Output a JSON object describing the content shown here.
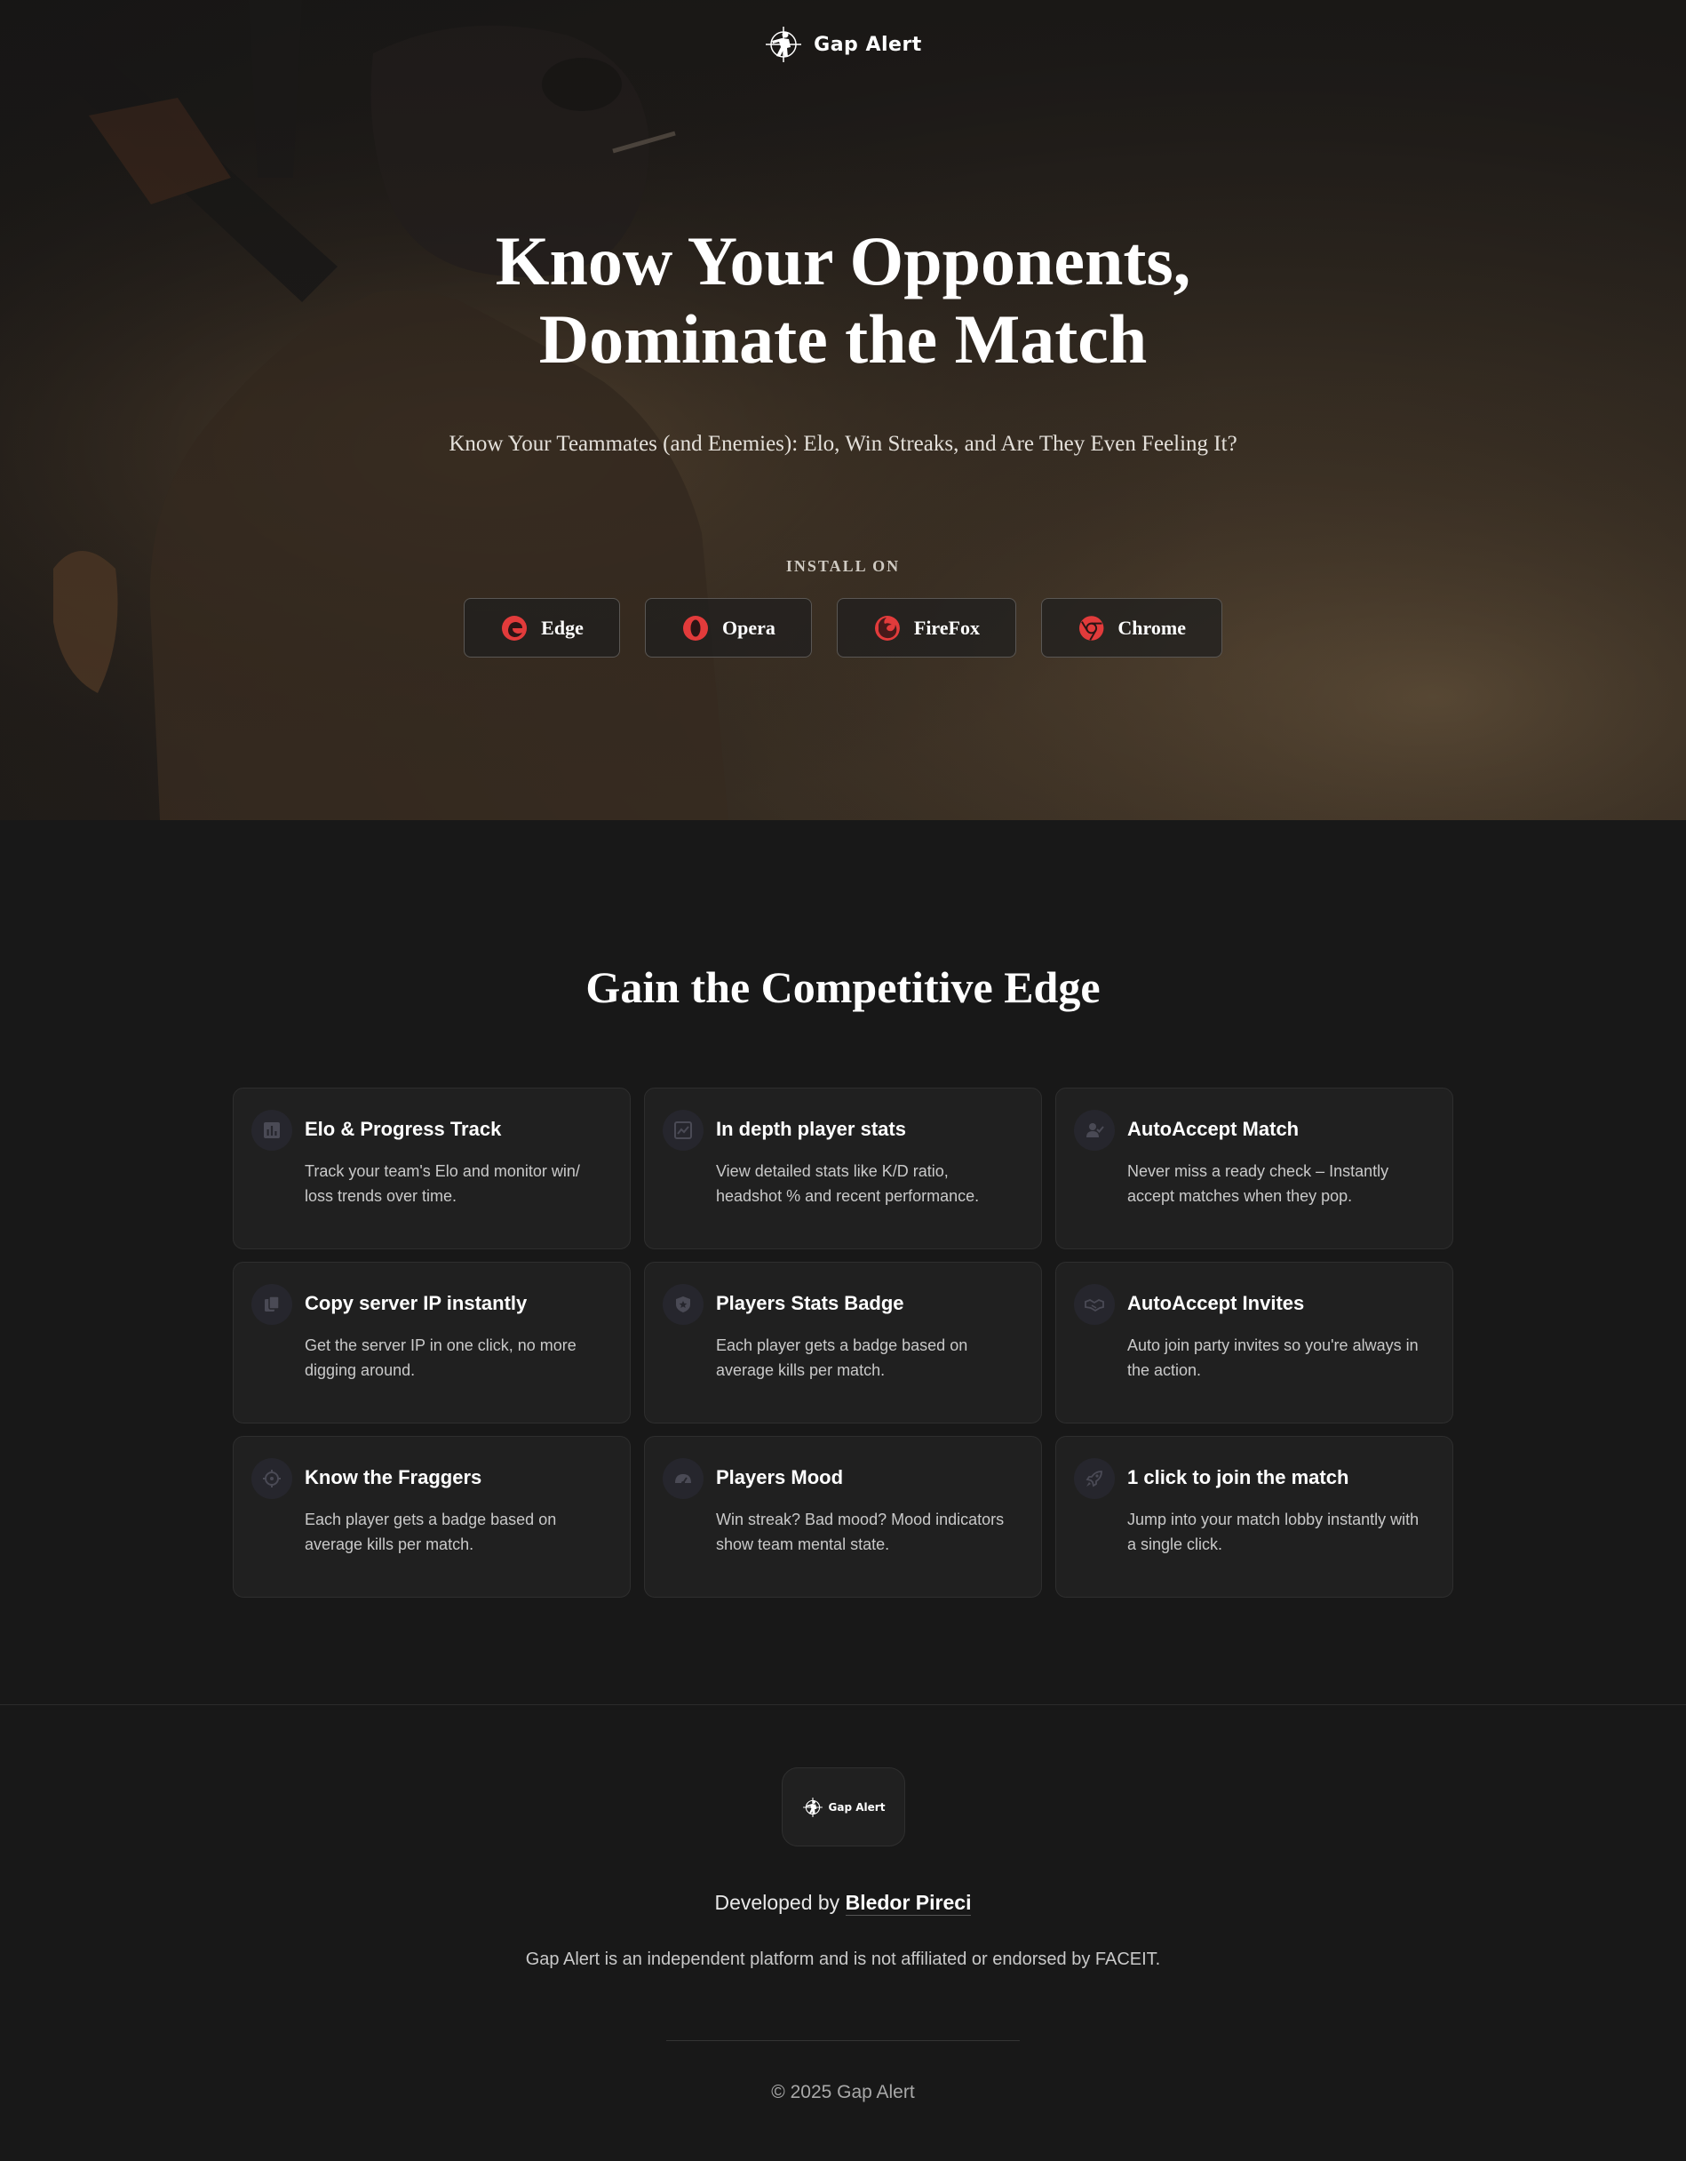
{
  "brand": {
    "name": "Gap Alert",
    "logo_icon": "soldier-logo-icon"
  },
  "hero": {
    "title_line1": "Know Your Opponents,",
    "title_line2": "Dominate the Match",
    "subtitle": "Know Your Teammates (and Enemies): Elo, Win Streaks, and Are They Even Feeling It?",
    "install_label": "INSTALL ON",
    "browsers": [
      {
        "label": "Edge",
        "icon": "edge-icon"
      },
      {
        "label": "Opera",
        "icon": "opera-icon"
      },
      {
        "label": "FireFox",
        "icon": "firefox-icon"
      },
      {
        "label": "Chrome",
        "icon": "chrome-icon"
      }
    ],
    "accent_color": "#e23b3b"
  },
  "features": {
    "title": "Gain the Competitive Edge",
    "items": [
      {
        "title": "Elo & Progress Track",
        "desc_line1": "Track your team's Elo and monitor win/",
        "desc_line2": "loss trends over time.",
        "icon": "bar-chart-icon"
      },
      {
        "title": "In depth player stats",
        "desc_line1": "View detailed stats like K/D ratio,",
        "desc_line2": "headshot % and recent performance.",
        "icon": "trending-up-icon"
      },
      {
        "title": "AutoAccept Match",
        "desc_line1": "Never miss a ready check – Instantly",
        "desc_line2": "accept matches when they pop.",
        "icon": "user-check-icon"
      },
      {
        "title": "Copy server IP instantly",
        "desc_line1": "Get the server IP in one click, no more",
        "desc_line2": "digging around.",
        "icon": "copy-icon"
      },
      {
        "title": "Players Stats Badge",
        "desc_line1": "Each player gets a badge based on",
        "desc_line2": "average kills per match.",
        "icon": "badge-icon"
      },
      {
        "title": "AutoAccept Invites",
        "desc_line1": "Auto join party invites so you're always in",
        "desc_line2": "the action.",
        "icon": "handshake-icon"
      },
      {
        "title": "Know the Fraggers",
        "desc_line1": "Each player gets a badge based on",
        "desc_line2": "average kills per match.",
        "icon": "crosshair-icon"
      },
      {
        "title": "Players Mood",
        "desc_line1": "Win streak? Bad mood? Mood indicators",
        "desc_line2": "show team mental state.",
        "icon": "gauge-icon"
      },
      {
        "title": "1 click to join the match",
        "desc_line1": "Jump into your match lobby instantly with",
        "desc_line2": "a single click.",
        "icon": "rocket-icon"
      }
    ]
  },
  "footer": {
    "badge_name": "Gap Alert",
    "developed_by_prefix": "Developed by",
    "developer_name": "Bledor Pireci",
    "disclaimer": "Gap Alert is an independent platform and is not affiliated or endorsed by FACEIT.",
    "copyright": "© 2025 Gap Alert"
  }
}
